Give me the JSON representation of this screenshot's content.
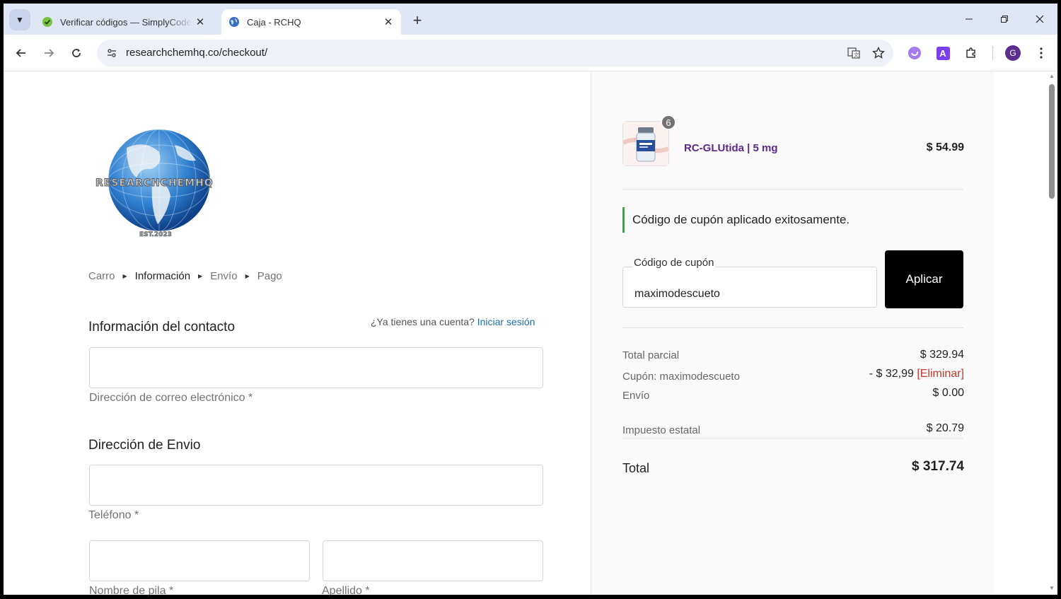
{
  "browser": {
    "tabs": [
      {
        "title": "Verificar códigos — SimplyCodes",
        "active": false
      },
      {
        "title": "Caja - RCHQ",
        "active": true
      }
    ],
    "url": "researchchemhq.co/checkout/",
    "profile_initial": "G",
    "ext_a_label": "A"
  },
  "logo": {
    "brand_text": "RESEARCHCHEMHQ",
    "est_text": "EST.2023"
  },
  "breadcrumb": {
    "items": [
      "Carro",
      "Información",
      "Envío",
      "Pago"
    ]
  },
  "contact": {
    "heading": "Información del contacto",
    "account_prompt": "¿Ya tienes una cuenta?",
    "login_link": "Iniciar sesión",
    "email_label": "Dirección de correo electrónico *"
  },
  "shipping": {
    "heading": "Dirección de Envio",
    "phone_label": "Teléfono *",
    "first_name_label": "Nombre de pila *",
    "last_name_label": "Apellido *"
  },
  "summary": {
    "quantity": "6",
    "product_name": "RC-GLUtida | 5 mg",
    "product_price": "$ 54.99",
    "coupon_notice": "Código de cupón aplicado exitosamente.",
    "coupon_label": "Código de cupón",
    "coupon_value": "maximodescueto",
    "apply_label": "Aplicar",
    "subtotal_label": "Total parcial",
    "subtotal_value": "$ 329.94",
    "coupon_line_label": "Cupón: maximodescueto",
    "coupon_line_value": "- $ 32,99",
    "coupon_remove": "[Eliminar]",
    "shipping_label": "Envío",
    "shipping_value": "$ 0.00",
    "tax_label": "Impuesto estatal",
    "tax_value": "$ 20.79",
    "total_label": "Total",
    "total_value": "$ 317.74"
  },
  "colors": {
    "accent_link": "#1f6fb0",
    "product_name": "#5a2a8a",
    "remove_link": "#c0392b",
    "notice_bar": "#4a9a52"
  }
}
